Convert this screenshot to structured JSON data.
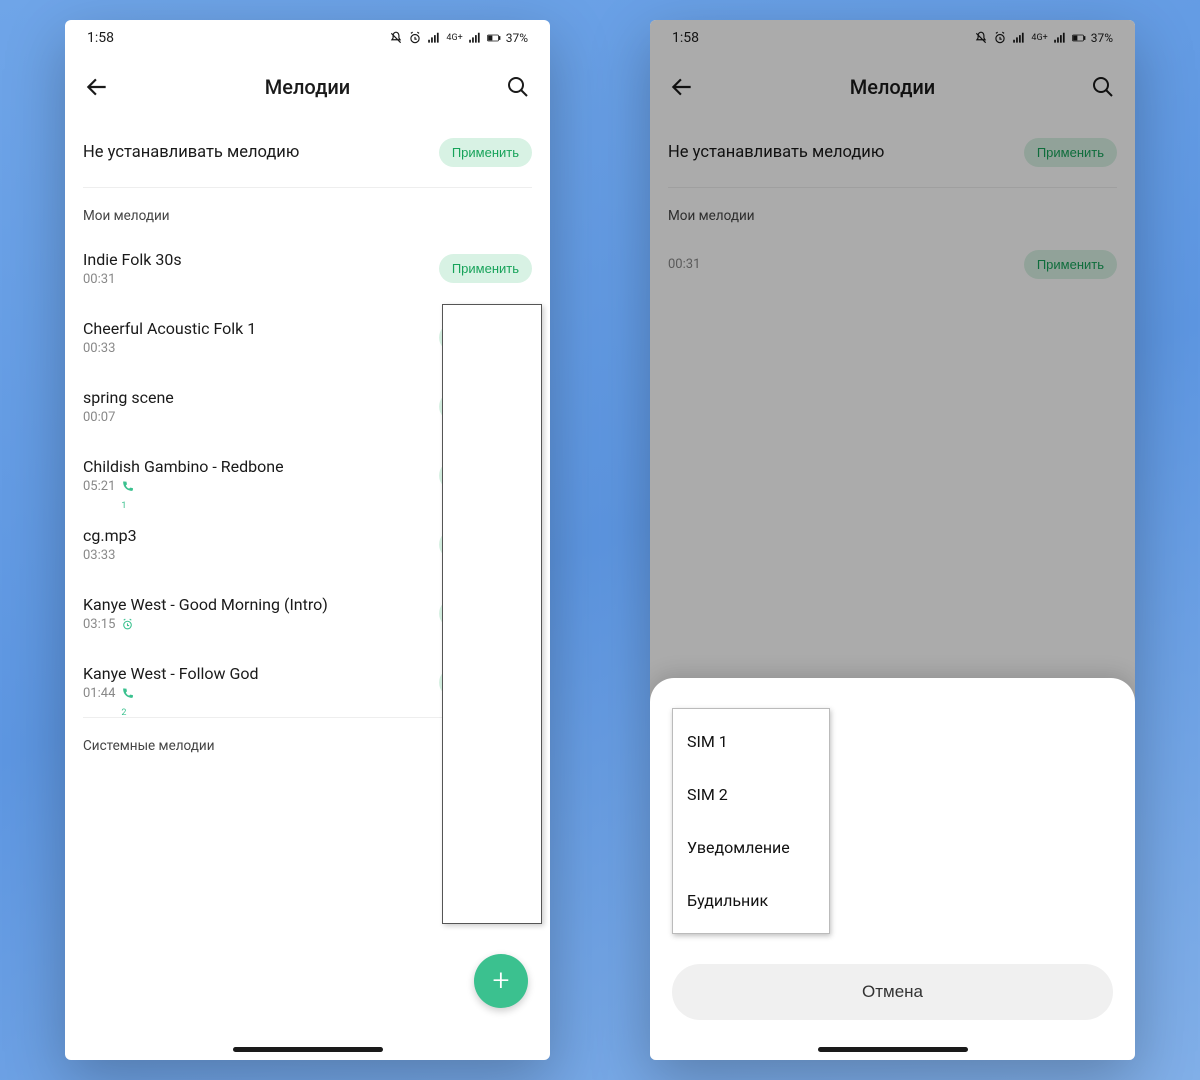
{
  "status": {
    "time": "1:58",
    "battery": "37%",
    "net_label": "4G+"
  },
  "header": {
    "title": "Мелодии"
  },
  "no_ringtone": {
    "label": "Не устанавливать мелодию",
    "apply": "Применить"
  },
  "sections": {
    "my": "Мои мелодии",
    "system": "Системные мелодии"
  },
  "apply_label": "Применить",
  "songs": [
    {
      "title": "Indie Folk 30s",
      "dur": "00:31",
      "icon": ""
    },
    {
      "title": "Cheerful Acoustic Folk 1",
      "dur": "00:33",
      "icon": ""
    },
    {
      "title": "spring scene",
      "dur": "00:07",
      "icon": ""
    },
    {
      "title": "Childish Gambino - Redbone",
      "dur": "05:21",
      "icon": "call1"
    },
    {
      "title": "cg.mp3",
      "dur": "03:33",
      "icon": ""
    },
    {
      "title": "Kanye West - Good Morning (Intro)",
      "dur": "03:15",
      "icon": "alarm"
    },
    {
      "title": "Kanye West - Follow God",
      "dur": "01:44",
      "icon": "call2"
    }
  ],
  "sheet": {
    "options": [
      "SIM 1",
      "SIM 2",
      "Уведомление",
      "Будильник"
    ],
    "cancel": "Отмена"
  }
}
